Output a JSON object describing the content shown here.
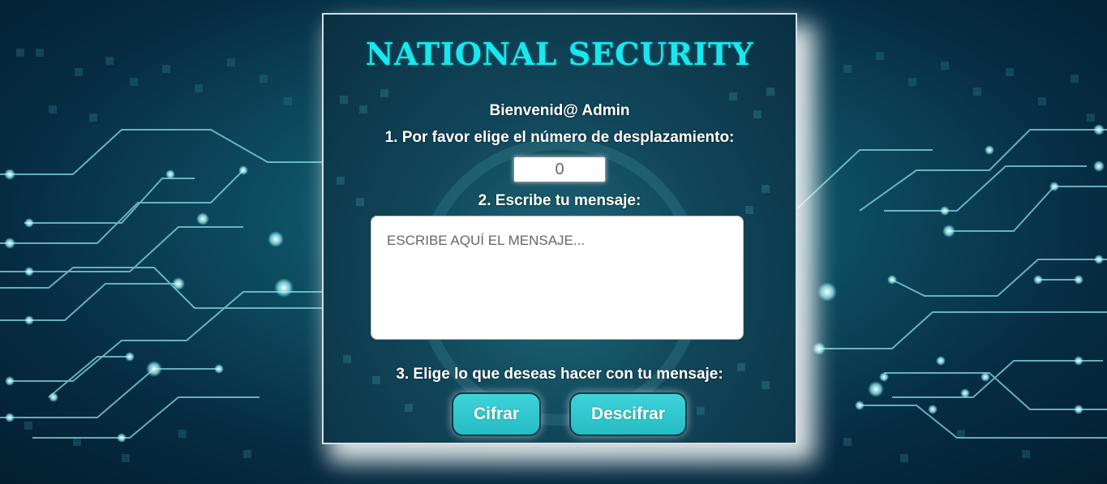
{
  "app": {
    "title": "NATIONAL SECURITY"
  },
  "form": {
    "welcome": "Bienvenid@ Admin",
    "step1_label": "1. Por favor elige el número de desplazamiento:",
    "shift_value": "0",
    "step2_label": "2. Escribe tu mensaje:",
    "message_placeholder": "ESCRIBE AQUÍ EL MENSAJE...",
    "message_value": "",
    "step3_label": "3. Elige lo que deseas hacer con tu mensaje:"
  },
  "actions": {
    "cipher_label": "Cifrar",
    "decipher_label": "Descifrar"
  },
  "colors": {
    "title": "#19e7ee",
    "button": "#2ec8cf",
    "panel_bg": "#11465a",
    "page_bg": "#062c42"
  },
  "background": {
    "decoration": "circuit-board"
  }
}
